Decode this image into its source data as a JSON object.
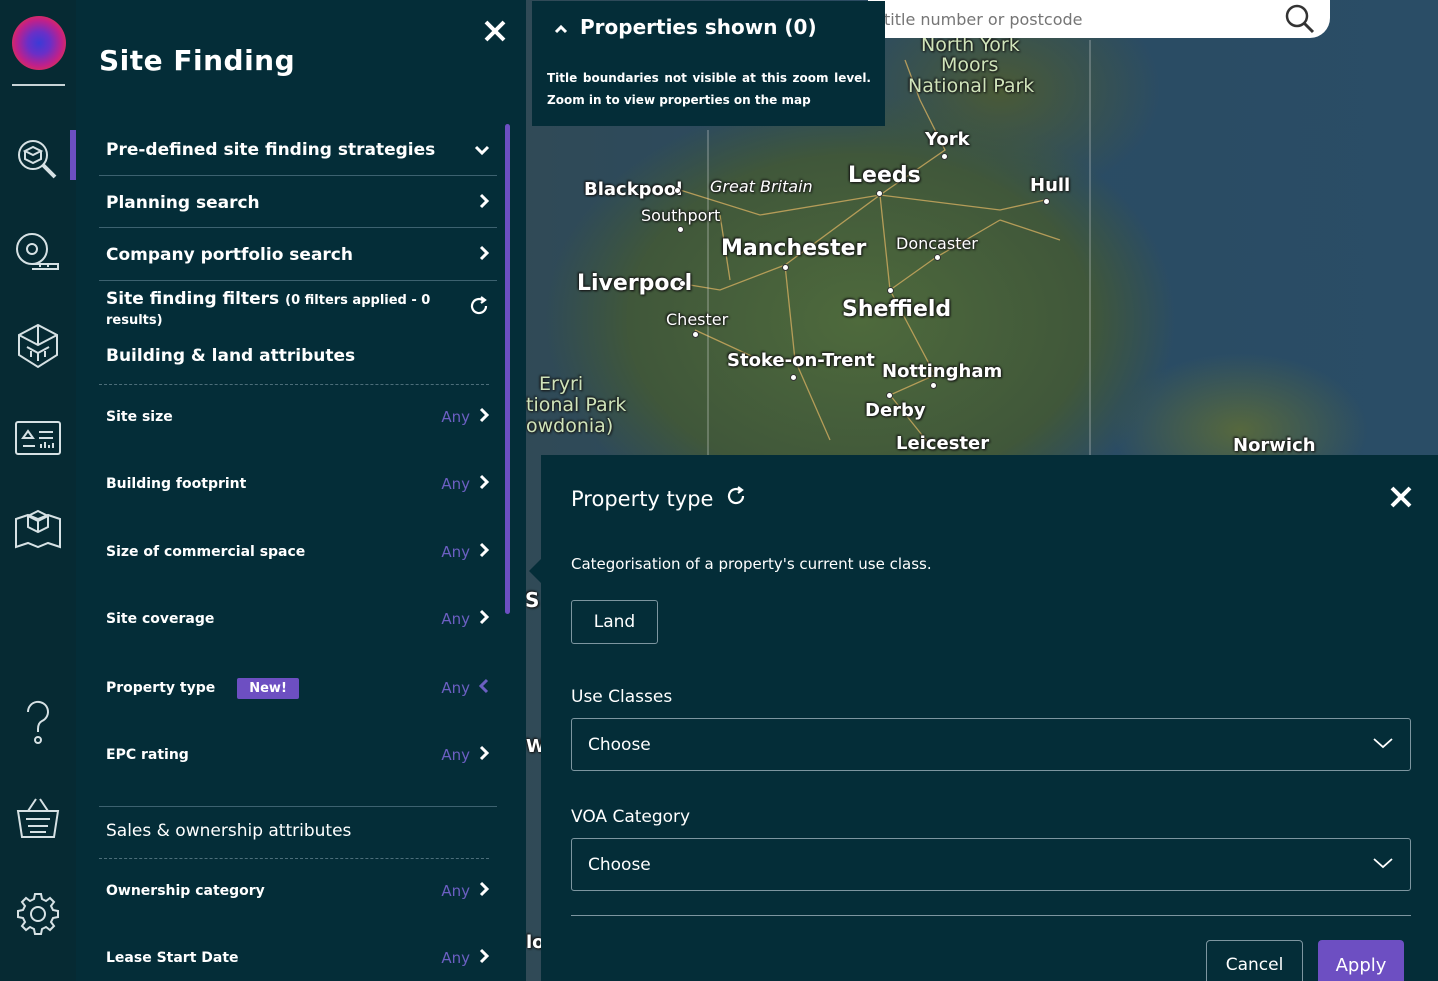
{
  "panel": {
    "title": "Site Finding",
    "nav": [
      {
        "label": "Pre-defined site finding strategies"
      },
      {
        "label": "Planning search"
      },
      {
        "label": "Company portfolio search"
      }
    ],
    "filters_heading": "Site finding filters",
    "filters_summary": "(0 filters applied - 0 results)",
    "building_section": "Building & land attributes",
    "filters": [
      {
        "label": "Site size",
        "value": "Any"
      },
      {
        "label": "Building footprint",
        "value": "Any"
      },
      {
        "label": "Size of commercial space",
        "value": "Any"
      },
      {
        "label": "Site coverage",
        "value": "Any"
      },
      {
        "label": "Property type",
        "value": "Any",
        "badge": "New!"
      },
      {
        "label": "EPC rating",
        "value": "Any"
      }
    ],
    "sales_section": "Sales & ownership attributes",
    "sales_filters": [
      {
        "label": "Ownership category",
        "value": "Any"
      },
      {
        "label": "Lease Start Date",
        "value": "Any"
      }
    ]
  },
  "properties": {
    "title": "Properties shown (0)",
    "message": "Title boundaries not visible at this zoom level. Zoom in to view properties on the map"
  },
  "search": {
    "placeholder": "title number or postcode"
  },
  "map": {
    "labels": [
      {
        "text": "North York",
        "cls": "park"
      },
      {
        "text": "Moors",
        "cls": "park"
      },
      {
        "text": "National Park",
        "cls": "park"
      },
      {
        "text": "York",
        "cls": "med"
      },
      {
        "text": "Leeds",
        "cls": "big"
      },
      {
        "text": "Hull",
        "cls": "med"
      },
      {
        "text": "Blackpool",
        "cls": "med"
      },
      {
        "text": "Great Britain",
        "cls": "sm"
      },
      {
        "text": "Southport",
        "cls": "sm"
      },
      {
        "text": "Manchester",
        "cls": "big"
      },
      {
        "text": "Doncaster",
        "cls": "sm"
      },
      {
        "text": "Liverpool",
        "cls": "big"
      },
      {
        "text": "Sheffield",
        "cls": "big"
      },
      {
        "text": "Chester",
        "cls": "sm"
      },
      {
        "text": "Stoke-on-Trent",
        "cls": "med"
      },
      {
        "text": "Nottingham",
        "cls": "med"
      },
      {
        "text": "Eryri",
        "cls": "park"
      },
      {
        "text": "tional Park",
        "cls": "park"
      },
      {
        "text": "owdonia)",
        "cls": "park"
      },
      {
        "text": "Derby",
        "cls": "med"
      },
      {
        "text": "Leicester",
        "cls": "med"
      },
      {
        "text": "Norwich",
        "cls": "med"
      }
    ],
    "edge_letters": [
      "S",
      "W",
      "lo"
    ]
  },
  "dialog": {
    "title": "Property type",
    "description": "Categorisation of a property's current use class.",
    "chip": "Land",
    "use_classes_label": "Use Classes",
    "use_classes_value": "Choose",
    "voa_label": "VOA Category",
    "voa_value": "Choose",
    "cancel": "Cancel",
    "apply": "Apply"
  },
  "colors": {
    "panel_bg": "#042d38",
    "accent": "#6d4fc2"
  }
}
